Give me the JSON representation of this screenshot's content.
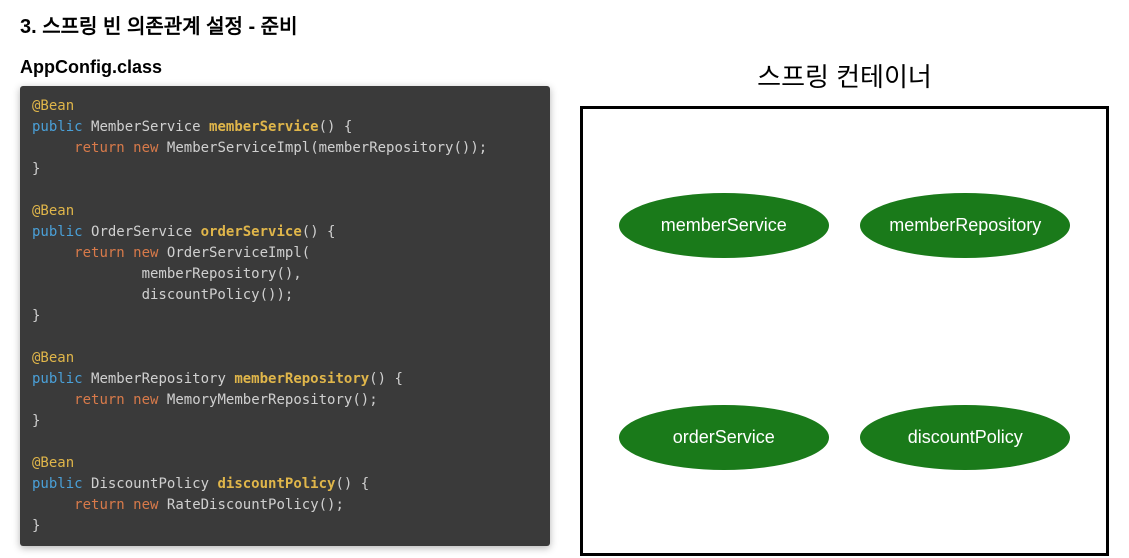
{
  "title": "3. 스프링 빈 의존관계 설정 - 준비",
  "left": {
    "classLabel": "AppConfig.class",
    "code": {
      "beanAnnotation": "@Bean",
      "kwPublic": "public",
      "kwReturn": "return",
      "kwNew": "new",
      "methods": [
        {
          "returnType": "MemberService",
          "name": "memberService",
          "bodyCall": "MemberServiceImpl(memberRepository());"
        },
        {
          "returnType": "OrderService",
          "name": "orderService",
          "bodyCall": "OrderServiceImpl(",
          "args": [
            "memberRepository(),",
            "discountPolicy());"
          ]
        },
        {
          "returnType": "MemberRepository",
          "name": "memberRepository",
          "bodyCall": "MemoryMemberRepository();"
        },
        {
          "returnType": "DiscountPolicy",
          "name": "discountPolicy",
          "bodyCall": "RateDiscountPolicy();"
        }
      ]
    }
  },
  "right": {
    "title": "스프링 컨테이너",
    "beans": [
      "memberService",
      "memberRepository",
      "orderService",
      "discountPolicy"
    ]
  },
  "colors": {
    "codeBg": "#3a3a3a",
    "beanGreen": "#1a7a1a",
    "annotation": "#e0b64a",
    "keyword": "#4aa0d8",
    "retNew": "#d87a4a"
  }
}
